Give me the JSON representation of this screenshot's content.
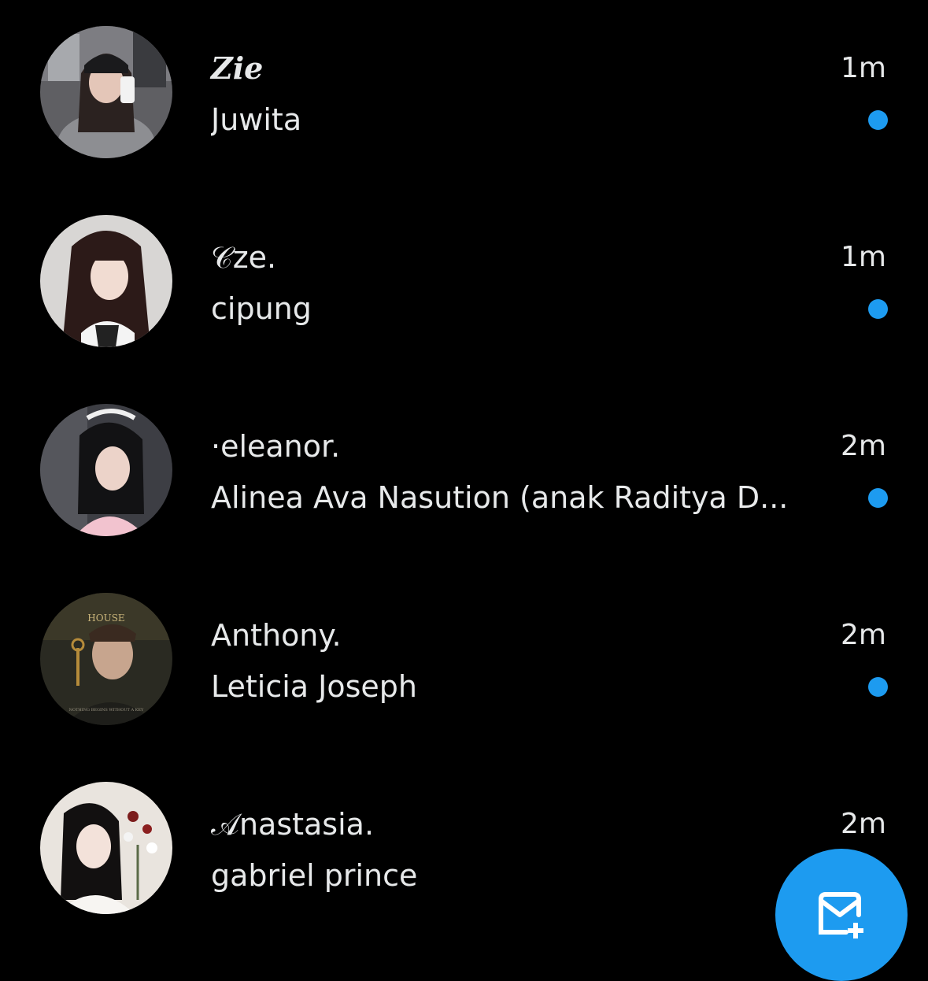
{
  "colors": {
    "background": "#000000",
    "text": "#e7e9ea",
    "accent": "#1d9bf0"
  },
  "conversations": [
    {
      "name": "Zie",
      "preview": "Juwita",
      "time": "1m",
      "unread": true
    },
    {
      "name": "𝒞ze.",
      "preview": "cipung",
      "time": "1m",
      "unread": true
    },
    {
      "name": "·eleanor.",
      "preview": "Alinea Ava Nasution (anak Raditya D...",
      "time": "2m",
      "unread": true
    },
    {
      "name": "Anthony.",
      "preview": "Leticia Joseph",
      "time": "2m",
      "unread": true
    },
    {
      "name": "𝒜nastasia.",
      "preview": "gabriel prince",
      "time": "2m",
      "unread": false
    }
  ],
  "fab": {
    "icon": "new-message-icon"
  },
  "avatars": {
    "3": {
      "poster_title": "HOUSE",
      "poster_tagline": "NOTHING BEGINS WITHOUT A KEY"
    }
  }
}
